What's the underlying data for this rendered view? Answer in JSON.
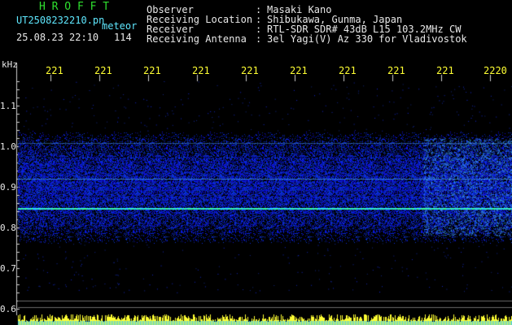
{
  "header": {
    "brand": "H R O F F T",
    "file_name": "UT2508232210.pn",
    "meteor_label": "meteor",
    "datetime": "25.08.23 22:10",
    "count": "114",
    "observer_label": "Observer",
    "location_label": "Receiving Location",
    "receiver_label": "Receiver",
    "antenna_label": "Receiving Antenna",
    "colon": ":",
    "observer": "Masaki Kano",
    "location": "Shibukawa, Gunma, Japan",
    "receiver": "RTL-SDR SDR# 43dB L15 103.2MHz CW",
    "antenna": "3el Yagi(V) Az 330 for Vladivostok"
  },
  "axis": {
    "unit": "kHz",
    "x_ticks": [
      "221",
      "221",
      "221",
      "221",
      "221",
      "221",
      "221",
      "221",
      "221",
      "2220"
    ],
    "y_ticks": [
      "1.1",
      "1.0",
      "0.9",
      "0.8",
      "0.7",
      "0.6"
    ]
  },
  "colors": {
    "background": "#000000",
    "signal_blue": "#1a3cff",
    "meteor_line": "#3cff9a",
    "tick_yellow": "#ffff33",
    "text_green": "#2fe02f",
    "text_cyan": "#5fe8ff"
  }
}
